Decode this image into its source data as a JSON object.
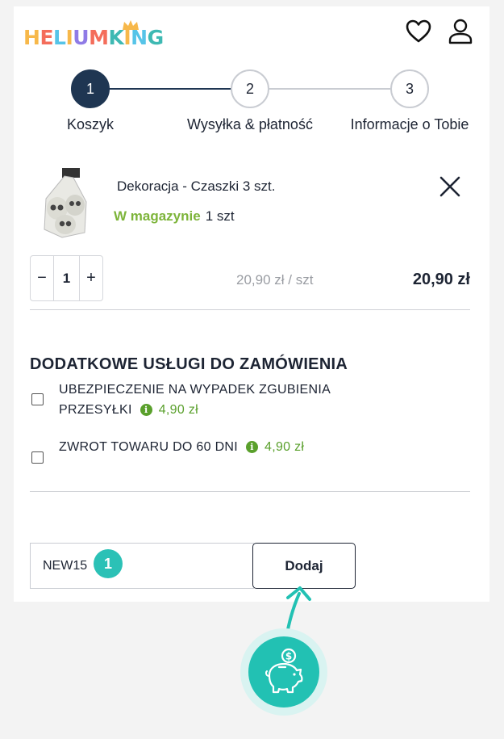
{
  "brand": {
    "logo_text": "HELIUMKING",
    "logo_letters": [
      {
        "c": "H",
        "color": "#f7b84a"
      },
      {
        "c": "E",
        "color": "#f46d5b"
      },
      {
        "c": "L",
        "color": "#56c4e8"
      },
      {
        "c": "I",
        "color": "#f7b84a"
      },
      {
        "c": "U",
        "color": "#8f7be6"
      },
      {
        "c": "M",
        "color": "#f46d5b"
      },
      {
        "c": "K",
        "color": "#3eb9b3"
      },
      {
        "c": "I",
        "color": "#f7b84a"
      },
      {
        "c": "N",
        "color": "#56c4e8"
      },
      {
        "c": "G",
        "color": "#3eb9b3"
      }
    ]
  },
  "header": {
    "wishlist_icon": "heart-icon",
    "account_icon": "user-icon"
  },
  "steps": [
    {
      "number": "1",
      "label": "Koszyk",
      "active": true
    },
    {
      "number": "2",
      "label": "Wysyłka & płatność",
      "active": false
    },
    {
      "number": "3",
      "label": "Informacje o Tobie",
      "active": false
    }
  ],
  "cart": {
    "item": {
      "name": "Dekoracja - Czaszki 3 szt.",
      "stock_status": "W magazynie",
      "stock_qty": "1 szt",
      "quantity": "1",
      "decrement": "−",
      "increment": "+",
      "unit_price": "20,90 zł / szt",
      "total_price": "20,90 zł"
    }
  },
  "extras": {
    "title": "DODATKOWE USŁUGI DO ZAMÓWIENIA",
    "options": [
      {
        "label_line1": "UBEZPIECZENIE NA WYPADEK ZGUBIENIA",
        "label_line2": "PRZESYŁKI",
        "price": "4,90 zł",
        "checked": false
      },
      {
        "label_line1": "ZWROT TOWARU DO 60 DNI",
        "price": "4,90 zł",
        "checked": false
      }
    ],
    "info_glyph": "i"
  },
  "coupon": {
    "value": "NEW15",
    "badge": "1",
    "button_label": "Dodaj"
  },
  "colors": {
    "primary": "#1f3652",
    "in_stock": "#7db43a",
    "accent_teal": "#22c1b3",
    "price_green": "#5aa02c"
  }
}
